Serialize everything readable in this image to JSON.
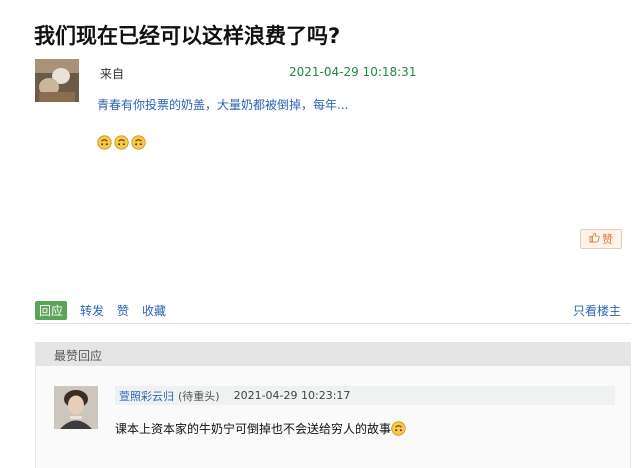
{
  "post": {
    "title": "我们现在已经可以这样浪费了吗?",
    "from_label": "来自",
    "time": "2021-04-29 10:18:31",
    "text": "青春有你投票的奶盖，大量奶都被倒掉，每年...",
    "emojis": [
      "upside-down-face-icon",
      "upside-down-face-icon",
      "upside-down-face-icon"
    ],
    "like_label": "赞"
  },
  "actions": {
    "reply": "回应",
    "repost": "转发",
    "like": "赞",
    "collect": "收藏",
    "only_op": "只看楼主"
  },
  "best_replies": {
    "header": "最赞回应",
    "items": [
      {
        "name": "萱照彩云归",
        "tag": "(待重头)",
        "time": "2021-04-29 10:23:17",
        "text": "课本上资本家的牛奶宁可倒掉也不会送给穷人的故事"
      }
    ]
  },
  "colors": {
    "link": "#2d64b3",
    "time_green": "#22883a",
    "reply_button": "#5ba45b",
    "like_orange": "#e07a3c"
  }
}
